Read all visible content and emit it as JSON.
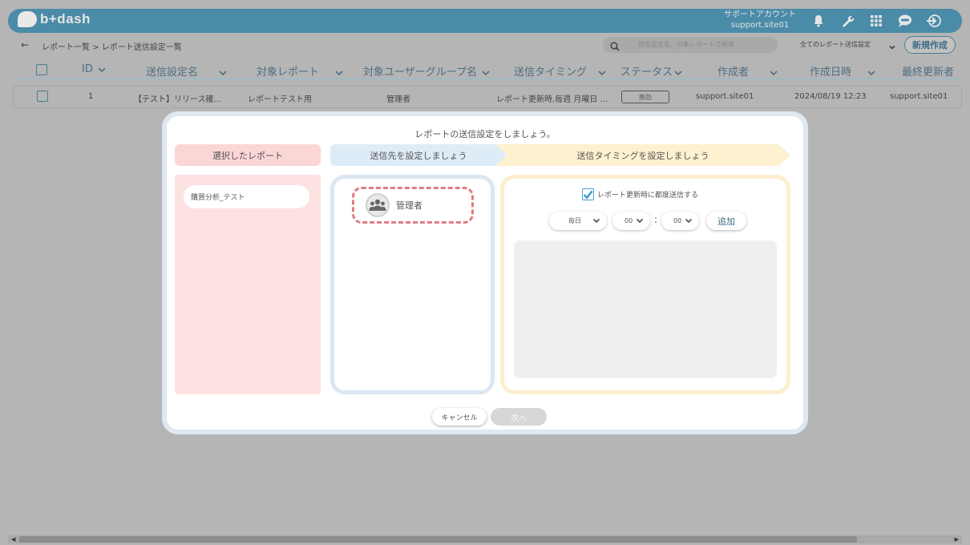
{
  "app": {
    "logo_text": "b+dash",
    "account": {
      "name": "サポートアカウント",
      "id": "support.site01"
    },
    "top_icons": [
      "bell-icon",
      "wrench-icon",
      "grid-icon",
      "chat-icon",
      "logout-icon"
    ]
  },
  "subbar": {
    "back_symbol": "←",
    "breadcrumb": "レポート一覧 > レポート送信設定一覧",
    "search_placeholder": "送信設定名、対象レポートで検索",
    "filter_value": "全てのレポート送信設定",
    "new_label": "新規作成"
  },
  "table": {
    "headers": {
      "id": "ID",
      "name": "送信設定名",
      "report": "対象レポート",
      "group": "対象ユーザーグループ名",
      "timing": "送信タイミング",
      "status": "ステータス",
      "creator": "作成者",
      "created": "作成日時",
      "updater": "最終更新者"
    },
    "rows": [
      {
        "id": "1",
        "name": "【テスト】リリース確...",
        "report": "レポートテスト用",
        "group": "管理者",
        "timing": "レポート更新時,毎週 月曜日 ...",
        "status": "無効",
        "creator": "support.site01",
        "created": "2024/08/19 12:23",
        "updater": "support.site01"
      }
    ]
  },
  "modal": {
    "title": "レポートの送信設定をしましょう。",
    "steps": [
      "選択したレポート",
      "送信先を設定しましょう",
      "送信タイミングを設定しましょう"
    ],
    "selected_report": "購買分析_テスト",
    "recipient": "管理者",
    "timing": {
      "checkbox_label": "レポート更新時に都度送信する",
      "frequency": "毎日",
      "hour": "00",
      "separator": ":",
      "minute": "00",
      "add_label": "追加"
    },
    "cancel_label": "キャンセル",
    "next_label": "次へ"
  },
  "colors": {
    "brand": "#4a8ba8",
    "step_report": "#fbd6d6",
    "step_recipient": "#deecf7",
    "step_timing": "#fdf1cf",
    "recipient_highlight": "#e27b84"
  }
}
